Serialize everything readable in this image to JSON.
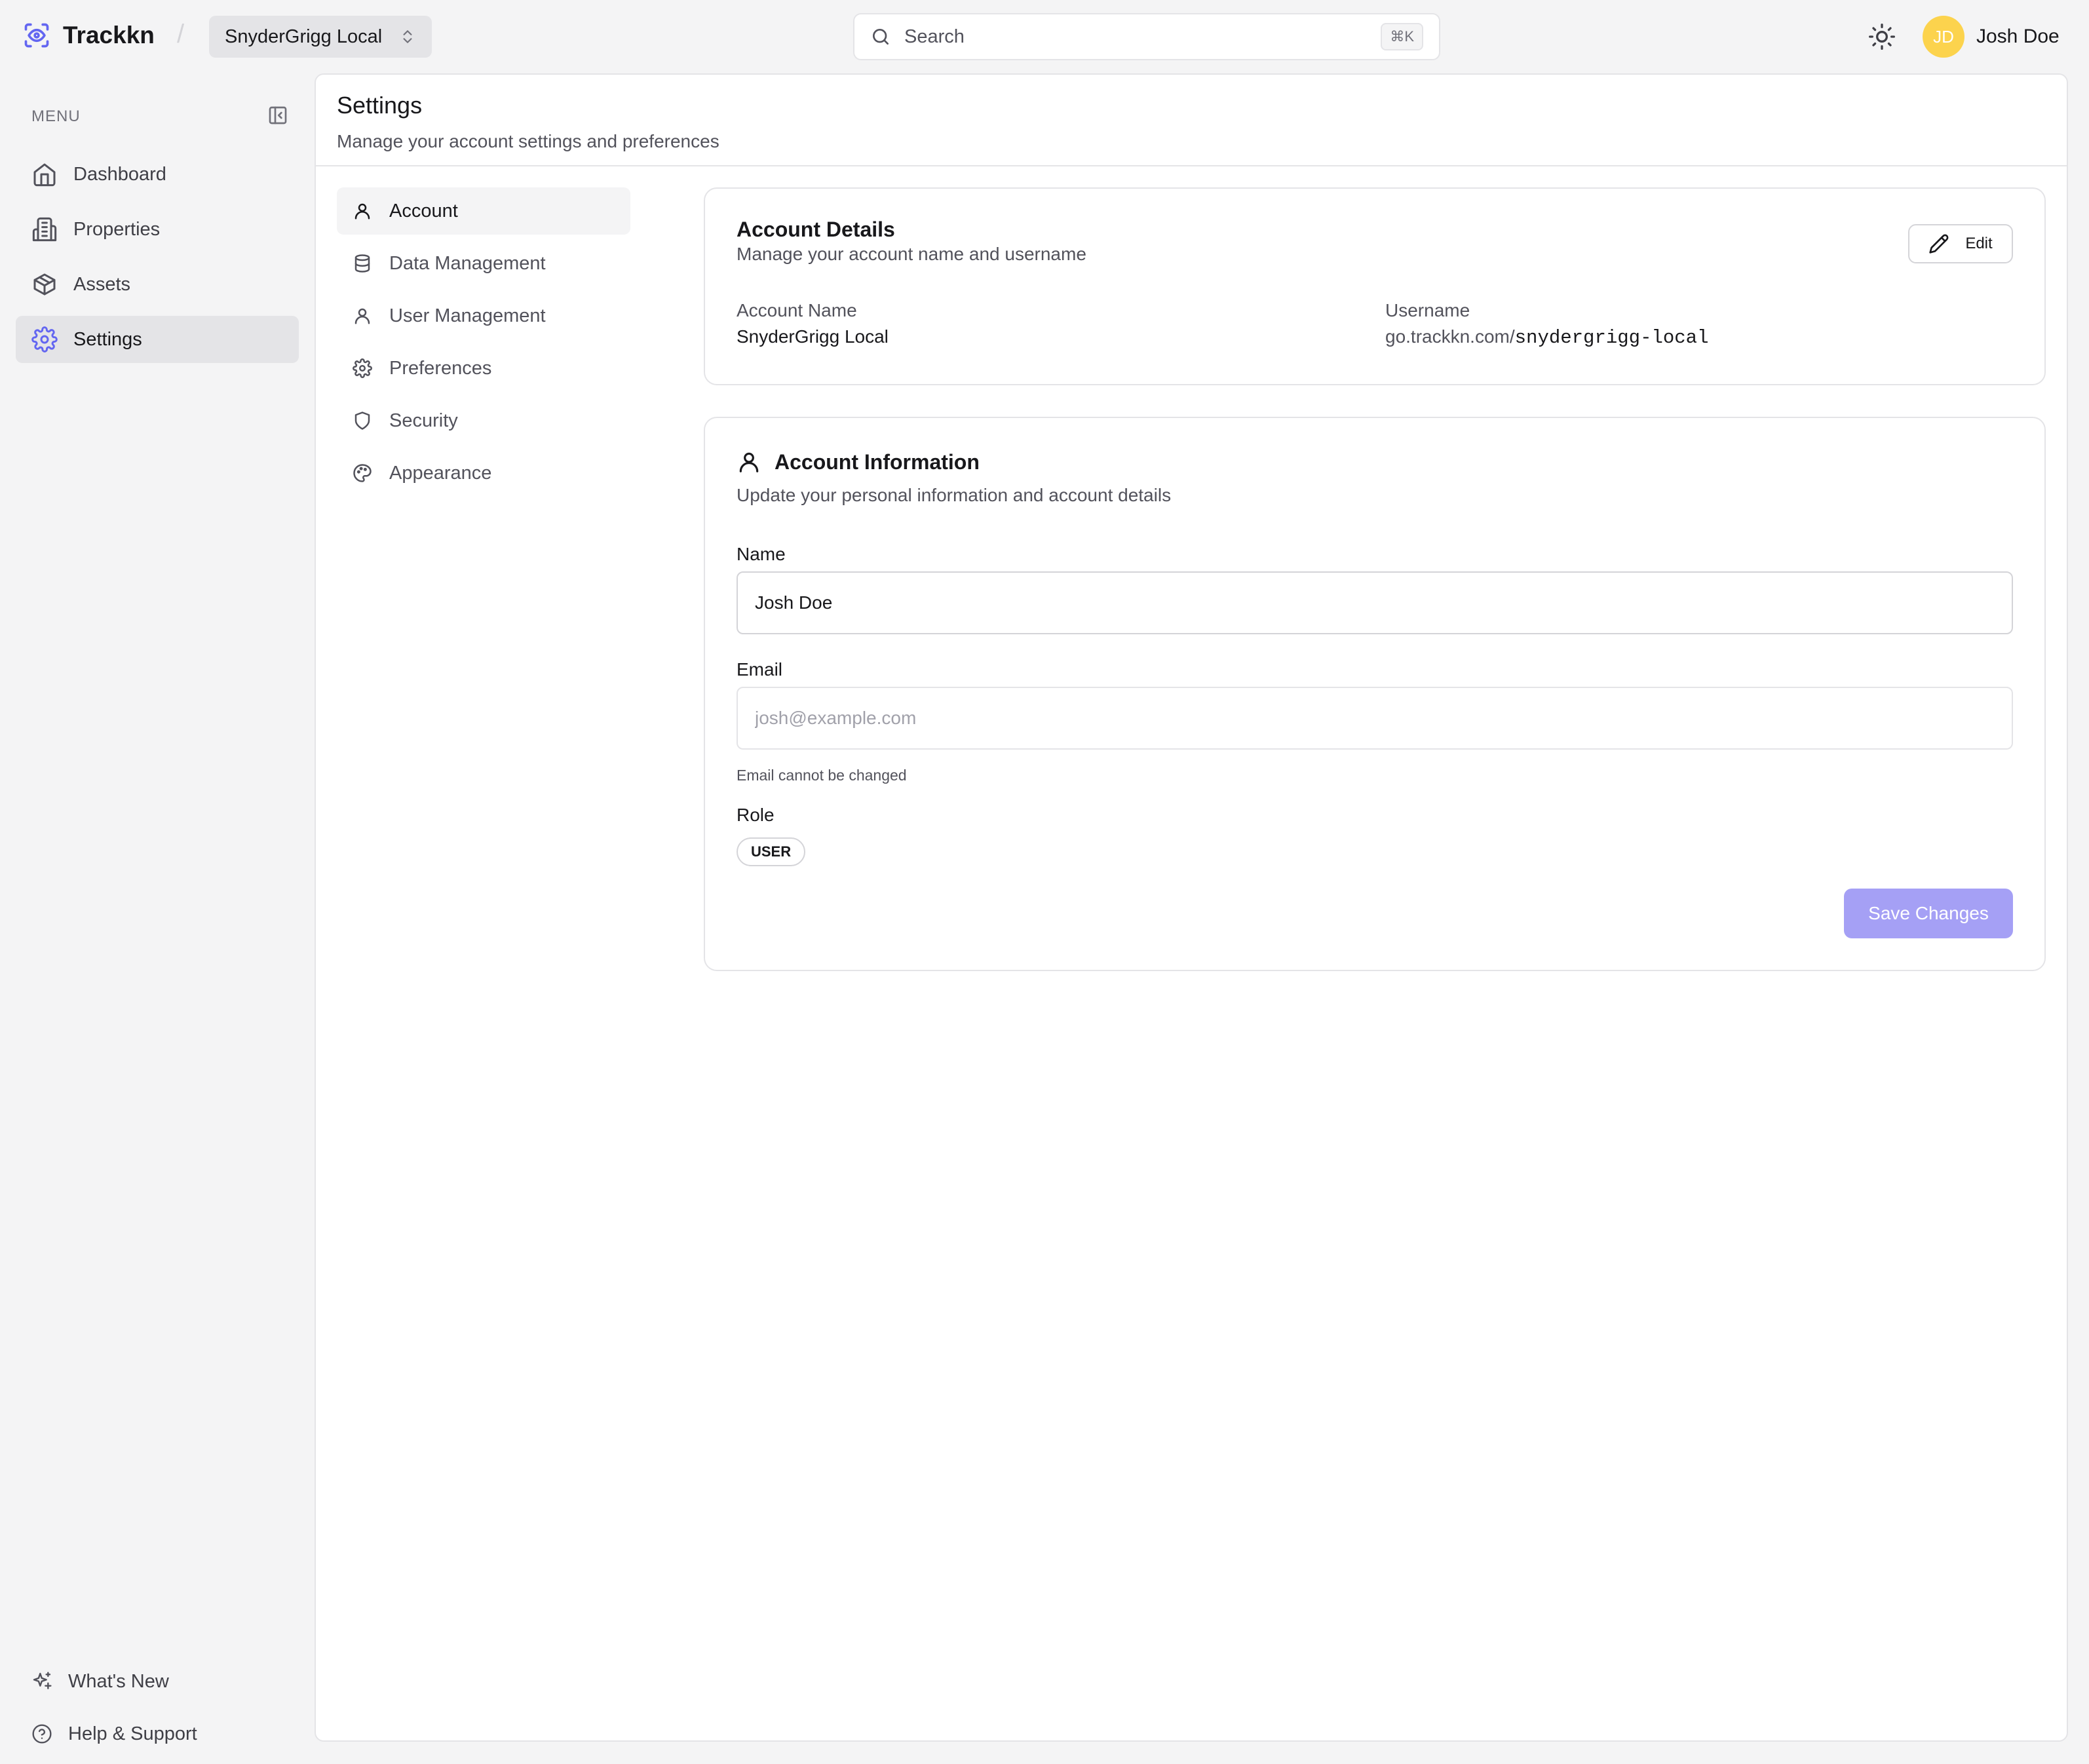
{
  "brand": {
    "name": "Trackkn"
  },
  "workspace": {
    "label": "SnyderGrigg Local"
  },
  "search": {
    "placeholder": "Search",
    "shortcut": "⌘K"
  },
  "user": {
    "initials": "JD",
    "name": "Josh Doe"
  },
  "sidebar": {
    "menu_title": "MENU",
    "items": [
      {
        "label": "Dashboard",
        "icon": "home-icon"
      },
      {
        "label": "Properties",
        "icon": "building-icon"
      },
      {
        "label": "Assets",
        "icon": "package-icon"
      },
      {
        "label": "Settings",
        "icon": "gear-icon",
        "active": true
      }
    ],
    "footer": [
      {
        "label": "What's New",
        "icon": "sparkles-icon"
      },
      {
        "label": "Help & Support",
        "icon": "help-circle-icon"
      }
    ]
  },
  "page": {
    "title": "Settings",
    "subtitle": "Manage your account settings and preferences"
  },
  "settings_nav": [
    {
      "label": "Account",
      "icon": "user-icon",
      "active": true
    },
    {
      "label": "Data Management",
      "icon": "database-icon"
    },
    {
      "label": "User Management",
      "icon": "user-icon"
    },
    {
      "label": "Preferences",
      "icon": "gear-icon"
    },
    {
      "label": "Security",
      "icon": "shield-icon"
    },
    {
      "label": "Appearance",
      "icon": "palette-icon"
    }
  ],
  "account_details": {
    "title": "Account Details",
    "description": "Manage your account name and username",
    "edit_label": "Edit",
    "account_name_label": "Account Name",
    "account_name": "SnyderGrigg Local",
    "username_label": "Username",
    "username_prefix": "go.trackkn.com/",
    "username": "snydergrigg-local"
  },
  "account_info": {
    "title": "Account Information",
    "description": "Update your personal information and account details",
    "name_label": "Name",
    "name_value": "Josh Doe",
    "email_label": "Email",
    "email_placeholder": "josh@example.com",
    "email_help": "Email cannot be changed",
    "role_label": "Role",
    "role": "USER",
    "save_label": "Save Changes"
  },
  "colors": {
    "accent": "#6366f1",
    "avatar": "#fcd34d",
    "save_button": "#a5a0f5"
  }
}
